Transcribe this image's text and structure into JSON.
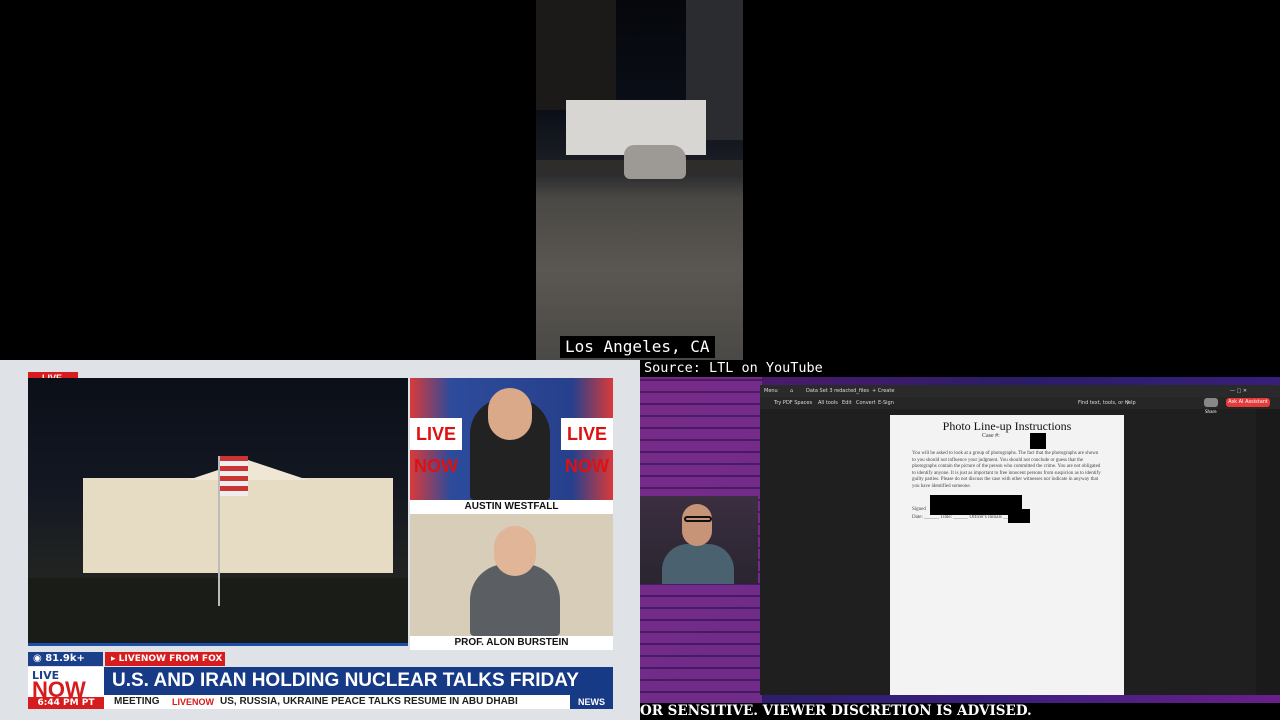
{
  "top_feed": {
    "location_caption": "Los Angeles, CA"
  },
  "news_panel": {
    "live_badge": "LIVE",
    "guest1": {
      "name": "AUSTIN WESTFALL",
      "logo": "LIVE NOW"
    },
    "guest2": {
      "name": "PROF. ALON BURSTEIN"
    },
    "viewers": "81.9k+",
    "source_tag": "LIVENOW FROM FOX",
    "brand_top": "LIVE",
    "brand_main": "NOW",
    "time": "6:44 PM PT",
    "headline": "U.S. AND IRAN HOLDING NUCLEAR TALKS FRIDAY",
    "crawl_left": "MEETING",
    "crawl_logo": "LIVENOW",
    "crawl_text": "US, RUSSIA, UKRAINE PEACE TALKS RESUME IN ABU DHABI",
    "crawl_badge": "NEWS"
  },
  "stream_panel": {
    "source_caption": "Source: LTL on YouTube",
    "app": {
      "tab_home": "Menu",
      "tab_file": "Data Set 3 redacted_files",
      "tab_new": "+ Create",
      "tools": [
        "Try PDF Spaces",
        "All tools",
        "Edit",
        "Convert",
        "E-Sign"
      ],
      "find_placeholder": "Find text, tools, or help",
      "share": "Share",
      "ai_button": "Ask AI Assistant"
    },
    "document": {
      "title": "Photo Line-up Instructions",
      "case_label": "Case #:",
      "body": "You will be asked to look at a group of photographs. The fact that the photographs are shown to you should not influence your judgment. You should not conclude or guess that the photographs contain the picture of the person who committed the crime. You are not obligated to identify anyone. It is just as important to free innocent persons from suspicion as to identify guilty parties. Please do not discuss the case with other witnesses nor indicate in anyway that you have identified someone.",
      "signed_label": "Signed",
      "date_line": "Date: ______ Time: ______ Officer's Initials ______"
    },
    "disclaimer": "OR SENSITIVE. VIEWER DISCRETION IS ADVISED."
  },
  "colors": {
    "fox_red": "#d61c1c",
    "fox_blue": "#163a86",
    "stream_purple": "#3a1f7c"
  }
}
